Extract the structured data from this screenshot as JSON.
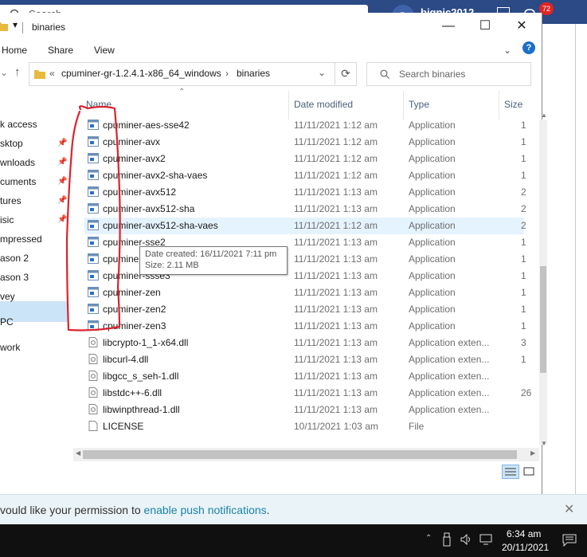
{
  "background": {
    "search_placeholder": "Search",
    "avatar_initial": "B",
    "username": "bignic2012",
    "notification_count": "72"
  },
  "window": {
    "title": "binaries",
    "controls": {
      "minimize": "—",
      "maximize": "☐",
      "close": "✕"
    },
    "ribbon": {
      "home": "Home",
      "share": "Share",
      "view": "View",
      "help": "?"
    },
    "address": {
      "prefix": "«",
      "segments": [
        "cpuminer-gr-1.2.4.1-x86_64_windows",
        "binaries"
      ],
      "separator": "›"
    },
    "search_placeholder": "Search binaries"
  },
  "nav_items": [
    {
      "label": "k access",
      "pinned": false
    },
    {
      "label": "sktop",
      "pinned": true
    },
    {
      "label": "wnloads",
      "pinned": true
    },
    {
      "label": "cuments",
      "pinned": true
    },
    {
      "label": "tures",
      "pinned": true
    },
    {
      "label": "isic",
      "pinned": true
    },
    {
      "label": "mpressed",
      "pinned": false
    },
    {
      "label": "ason 2",
      "pinned": false
    },
    {
      "label": "ason 3",
      "pinned": false
    },
    {
      "label": "vey",
      "pinned": false
    },
    {
      "label": "PC",
      "pinned": false,
      "selected": true
    },
    {
      "label": "work",
      "pinned": false
    }
  ],
  "columns": {
    "name": "Name",
    "date": "Date modified",
    "type": "Type",
    "size": "Size"
  },
  "files": [
    {
      "name": "cpuminer-aes-sse42",
      "date": "11/11/2021 1:12 am",
      "type": "Application",
      "size": "1",
      "kind": "app"
    },
    {
      "name": "cpuminer-avx",
      "date": "11/11/2021 1:12 am",
      "type": "Application",
      "size": "1",
      "kind": "app"
    },
    {
      "name": "cpuminer-avx2",
      "date": "11/11/2021 1:12 am",
      "type": "Application",
      "size": "1",
      "kind": "app"
    },
    {
      "name": "cpuminer-avx2-sha-vaes",
      "date": "11/11/2021 1:12 am",
      "type": "Application",
      "size": "1",
      "kind": "app"
    },
    {
      "name": "cpuminer-avx512",
      "date": "11/11/2021 1:13 am",
      "type": "Application",
      "size": "2",
      "kind": "app"
    },
    {
      "name": "cpuminer-avx512-sha",
      "date": "11/11/2021 1:13 am",
      "type": "Application",
      "size": "2",
      "kind": "app"
    },
    {
      "name": "cpuminer-avx512-sha-vaes",
      "date": "11/11/2021 1:12 am",
      "type": "Application",
      "size": "2",
      "kind": "app",
      "hover": true
    },
    {
      "name": "cpuminer-sse2",
      "date": "11/11/2021 1:13 am",
      "type": "Application",
      "size": "1",
      "kind": "app"
    },
    {
      "name": "cpuminer-sse42",
      "date": "11/11/2021 1:13 am",
      "type": "Application",
      "size": "1",
      "kind": "app"
    },
    {
      "name": "cpuminer-ssse3",
      "date": "11/11/2021 1:13 am",
      "type": "Application",
      "size": "1",
      "kind": "app"
    },
    {
      "name": "cpuminer-zen",
      "date": "11/11/2021 1:13 am",
      "type": "Application",
      "size": "1",
      "kind": "app"
    },
    {
      "name": "cpuminer-zen2",
      "date": "11/11/2021 1:13 am",
      "type": "Application",
      "size": "1",
      "kind": "app"
    },
    {
      "name": "cpuminer-zen3",
      "date": "11/11/2021 1:13 am",
      "type": "Application",
      "size": "1",
      "kind": "app"
    },
    {
      "name": "libcrypto-1_1-x64.dll",
      "date": "11/11/2021 1:13 am",
      "type": "Application exten...",
      "size": "3",
      "kind": "dll"
    },
    {
      "name": "libcurl-4.dll",
      "date": "11/11/2021 1:13 am",
      "type": "Application exten...",
      "size": "1",
      "kind": "dll"
    },
    {
      "name": "libgcc_s_seh-1.dll",
      "date": "11/11/2021 1:13 am",
      "type": "Application exten...",
      "size": "",
      "kind": "dll"
    },
    {
      "name": "libstdc++-6.dll",
      "date": "11/11/2021 1:13 am",
      "type": "Application exten...",
      "size": "26",
      "kind": "dll"
    },
    {
      "name": "libwinpthread-1.dll",
      "date": "11/11/2021 1:13 am",
      "type": "Application exten...",
      "size": "",
      "kind": "dll"
    },
    {
      "name": "LICENSE",
      "date": "10/11/2021 1:03 am",
      "type": "File",
      "size": "",
      "kind": "file"
    }
  ],
  "tooltip": {
    "line1": "Date created: 16/11/2021 7:11 pm",
    "line2": "Size: 2.11 MB"
  },
  "notification": {
    "text_before": "vould like your permission to ",
    "link": "enable push notifications",
    "text_after": ".",
    "close": "✕"
  },
  "taskbar": {
    "time": "6:34 am",
    "date": "20/11/2021"
  },
  "colors": {
    "annotation": "#d9232e",
    "app_bar": "#2b4a86",
    "selection": "#cce4f7",
    "hover": "#e5f3ff",
    "link": "#1a84a6"
  }
}
